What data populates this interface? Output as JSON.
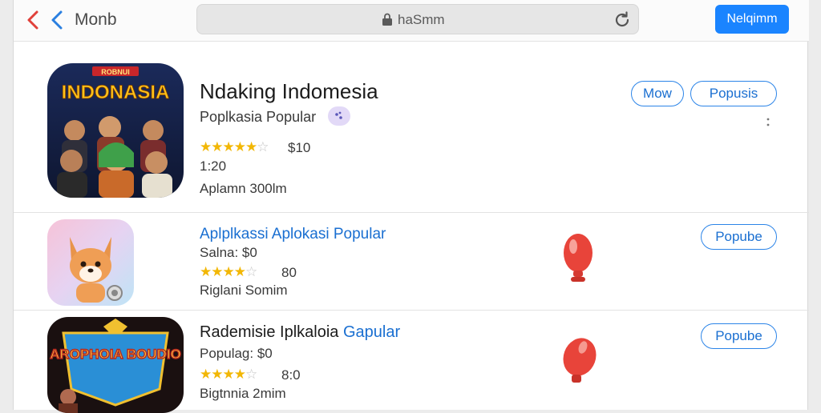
{
  "topbar": {
    "nav_title": "Monb",
    "url": "haSmm",
    "action_label": "Nelqimm",
    "icons": {
      "back": "chevron-left-icon",
      "forward": "chevron-right-icon",
      "lock": "lock-icon",
      "reload": "reload-icon"
    }
  },
  "featured": {
    "icon_text_small": "ROBNUI",
    "icon_text_big": "INDONASIA",
    "title": "Ndaking Indomesia",
    "subtitle": "Poplkasia Popular",
    "stars": "★★★★★",
    "rating": "$10",
    "meta1": "1:20",
    "meta2": "Aplamn 300lm",
    "pills": [
      "Mow",
      "Popusis"
    ]
  },
  "apps": [
    {
      "title": "Aplplkassi Aplokasi Popular",
      "price": "Salna: $0",
      "stars": "★★★★",
      "rating": "80",
      "meta": "Riglani Somim",
      "button": "Popube"
    },
    {
      "title": "Rademisie Iplkaloia",
      "title_accent": "Gapular",
      "icon_text": "AROPHOIA BOUDIO",
      "price": "Populag: $0",
      "stars": "★★★★",
      "rating": "8:0",
      "meta": "Bigtnnia 2mim",
      "button": "Popube"
    }
  ],
  "colors": {
    "accent": "#1a84ff",
    "link": "#1a6fd1",
    "star": "#f2b705",
    "balloon": "#e8443a"
  }
}
